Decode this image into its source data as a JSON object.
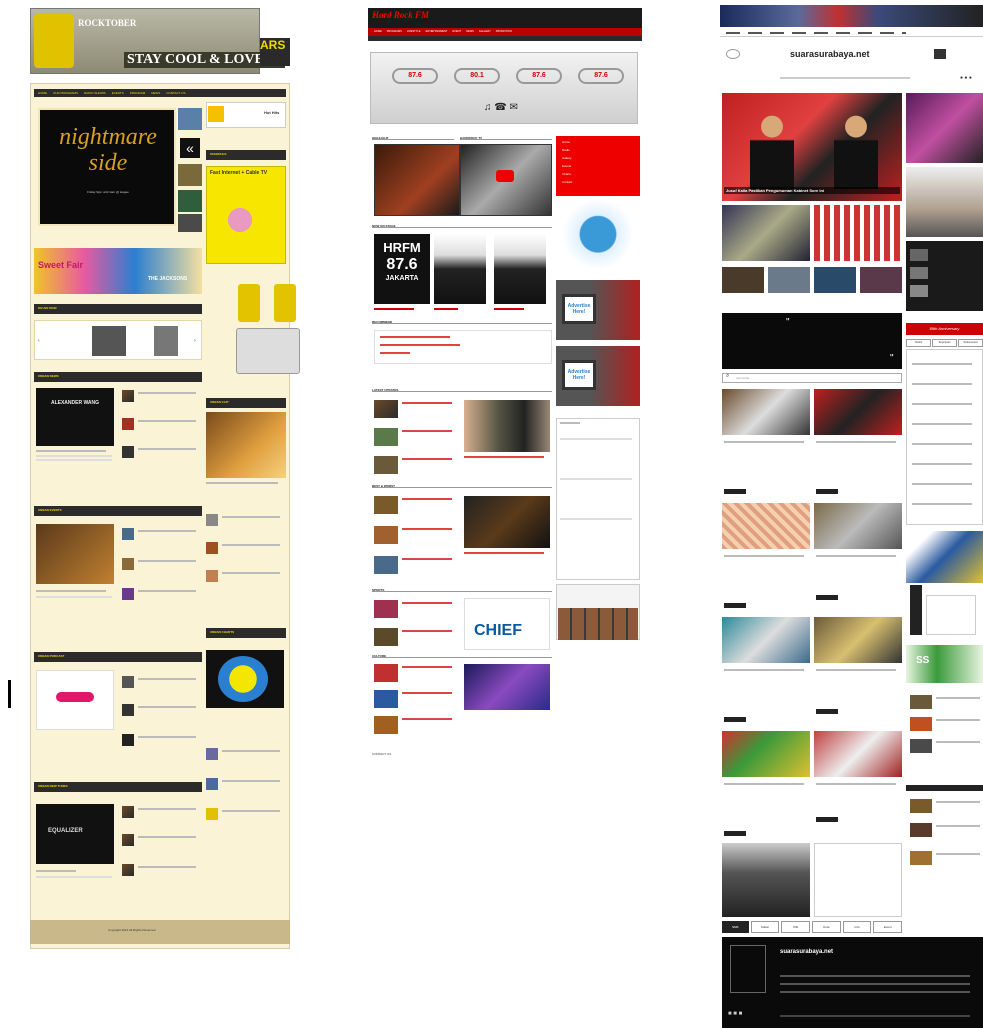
{
  "site1": {
    "banner_title": "STAY COOL & LOVELY",
    "banner_logo": "ROCKTOBER",
    "banner_side": "ARS",
    "nav": [
      "HOME",
      "OUR PROGRAMS",
      "RADIO SHOWS",
      "EVENTS",
      "PROGRAM",
      "NEWS",
      "CONTACT US"
    ],
    "feature_title": "nightmare side",
    "feature_sub": "Friday 9pm until 1am @ stagee",
    "sidebar_logo": "Hot Hits",
    "cable_ad": "Fast Internet + Cable TV",
    "sections": [
      "ON AIR NOW",
      "URBAN NEWS",
      "URBAN EVENTS",
      "URBAN PODCAST",
      "URBAN NEW TUNES",
      "URBAN CLIP",
      "URBAN CHARTS"
    ],
    "special_fair": "Sweet Fair",
    "jacksons": "THE JACKSONS",
    "alexander": "ALEXANDER WANG",
    "equalizer": "EQUALIZER",
    "footer": "Copyright 2014 All Rights Reserved"
  },
  "site2": {
    "logo": "Hard Rock FM",
    "nav": [
      "HOME",
      "PROGRAMS",
      "LIFESTYLE",
      "ENTERTAINMENT",
      "EVENT",
      "NEWS",
      "GALLERY",
      "PROMOTION"
    ],
    "stations": [
      "87.6",
      "80.1",
      "87.6",
      "87.6"
    ],
    "sections": [
      "HIGHLIGHT",
      "HARDROCK TV",
      "NOW ON STAGE",
      "RECOMMEND",
      "LATEST UPDATES",
      "BEST & WORST",
      "SPORTS",
      "CULTURE"
    ],
    "hrfm_line1": "HRFM",
    "hrfm_line2": "87.6",
    "hrfm_line3": "JAKARTA",
    "menu": [
      "Home",
      "Radio",
      "Gallery",
      "Events",
      "Charts",
      "Contact"
    ],
    "advertise": "Advertise Here!",
    "chief": "CHIEF",
    "contact": "CONTACT US"
  },
  "site3": {
    "logo": "suarasurabaya.net",
    "headline": "Jusuf Kalla Pastikan Pengumuman Kabinet Sore Ini",
    "search_placeholder": "cari berita...",
    "tabs": [
      "Terkini",
      "Terpopuler",
      "Terkomentar"
    ],
    "bottom_tabs": [
      "SMK",
      "Kabar",
      "Klik",
      "Kota",
      "Info",
      "Event"
    ],
    "footer_logo": "suarasurabaya.net",
    "sidebar_badge": "89th Anniversary",
    "ss_logo": "SS"
  }
}
